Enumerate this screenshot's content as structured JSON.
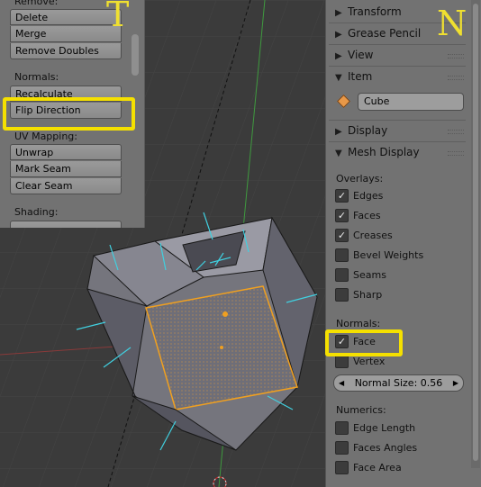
{
  "tool_shelf": {
    "letter": "T",
    "remove_heading": "Remove:",
    "delete_label": "Delete",
    "merge_label": "Merge",
    "remove_doubles_label": "Remove Doubles",
    "normals_heading": "Normals:",
    "recalculate_label": "Recalculate",
    "flip_direction_label": "Flip Direction",
    "uv_heading": "UV Mapping:",
    "unwrap_label": "Unwrap",
    "mark_seam_label": "Mark Seam",
    "clear_seam_label": "Clear Seam",
    "shading_heading": "Shading:"
  },
  "properties": {
    "letter": "N",
    "panels": {
      "transform": "Transform",
      "grease_pencil": "Grease Pencil",
      "view": "View",
      "item": "Item",
      "display": "Display",
      "mesh_display": "Mesh Display"
    },
    "item_name": "Cube",
    "overlays_heading": "Overlays:",
    "overlays": {
      "edges": "Edges",
      "faces": "Faces",
      "creases": "Creases",
      "bevel_weights": "Bevel Weights",
      "seams": "Seams",
      "sharp": "Sharp"
    },
    "normals_heading": "Normals:",
    "face_label": "Face",
    "vertex_label": "Vertex",
    "normal_size_label": "Normal Size: 0.56",
    "numerics_heading": "Numerics:",
    "numerics": {
      "edge_length": "Edge Length",
      "faces_angles": "Faces Angles",
      "face_area": "Face Area"
    }
  },
  "colors": {
    "highlight": "#f5e000",
    "face_select": "#f0a020",
    "normals": "#40d0e0"
  }
}
